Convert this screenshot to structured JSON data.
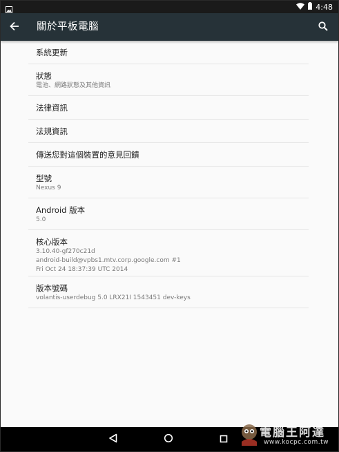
{
  "status_bar": {
    "time": "4:48",
    "icons": [
      "image-notification-icon",
      "wifi-icon",
      "battery-icon"
    ]
  },
  "app_bar": {
    "title": "關於平板電腦",
    "back_icon": "arrow-back-icon",
    "search_icon": "search-icon",
    "background": "#263238"
  },
  "settings_items": [
    {
      "title": "系統更新"
    },
    {
      "title": "狀態",
      "summary": "電池、網路狀態及其他資訊"
    },
    {
      "title": "法律資訊"
    },
    {
      "title": "法規資訊"
    },
    {
      "title": "傳送您對這個裝置的意見回饋"
    },
    {
      "title": "型號",
      "summary": "Nexus 9"
    },
    {
      "title": "Android 版本",
      "summary": "5.0"
    },
    {
      "title": "核心版本",
      "summary_lines": [
        "3.10.40-gf270c21d",
        "android-build@vpbs1.mtv.corp.google.com #1",
        "Fri Oct 24 18:37:39 UTC 2014"
      ]
    },
    {
      "title": "版本號碼",
      "summary": "volantis-userdebug 5.0 LRX21I 1543451 dev-keys"
    }
  ],
  "nav_bar": {
    "buttons": [
      "back-triangle-icon",
      "home-circle-icon",
      "recents-square-icon"
    ]
  },
  "watermark": {
    "text": "電腦王阿達",
    "url": "www.kocpc.com.tw"
  }
}
